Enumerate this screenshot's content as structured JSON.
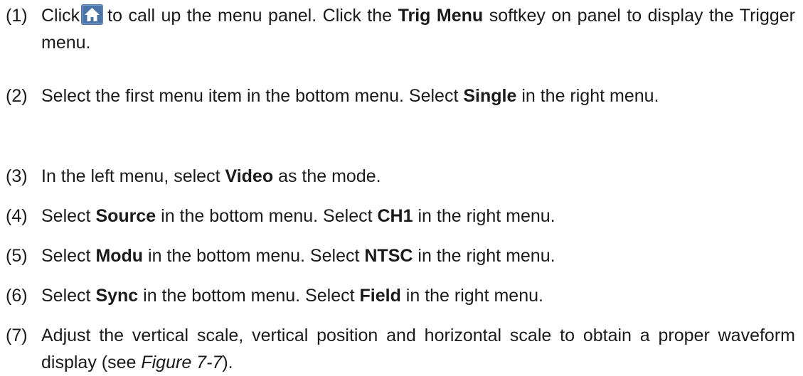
{
  "steps": [
    {
      "num": "(1)",
      "t1": "Click",
      "t2": "to call up the menu panel. Click the",
      "b1": "Trig Menu",
      "t3": "softkey on panel to display the Trigger menu."
    },
    {
      "num": "(2)",
      "t1": "Select the first menu item in the bottom menu. Select",
      "b1": "Single",
      "t2": "in the right menu."
    },
    {
      "num": "(3)",
      "t1": "In the left menu, select",
      "b1": "Video",
      "t2": "as the mode."
    },
    {
      "num": "(4)",
      "t1": "Select",
      "b1": "Source",
      "t2": "in the bottom menu. Select",
      "b2": "CH1",
      "t3": "in the right menu."
    },
    {
      "num": "(5)",
      "t1": "Select",
      "b1": "Modu",
      "t2": "in the bottom menu. Select",
      "b2": "NTSC",
      "t3": "in the right menu."
    },
    {
      "num": "(6)",
      "t1": "Select",
      "b1": "Sync",
      "t2": "in the bottom menu. Select",
      "b2": "Field",
      "t3": "in the right menu."
    },
    {
      "num": "(7)",
      "t1": "Adjust the vertical scale, vertical position and horizontal scale to obtain a proper waveform display (see",
      "i1": "Figure 7-7",
      "t2": ")."
    }
  ],
  "icons": {
    "home": "home-icon"
  },
  "colors": {
    "icon_bg": "#4a74a8",
    "icon_fg": "#ffffff",
    "text": "#1a1a1a"
  }
}
